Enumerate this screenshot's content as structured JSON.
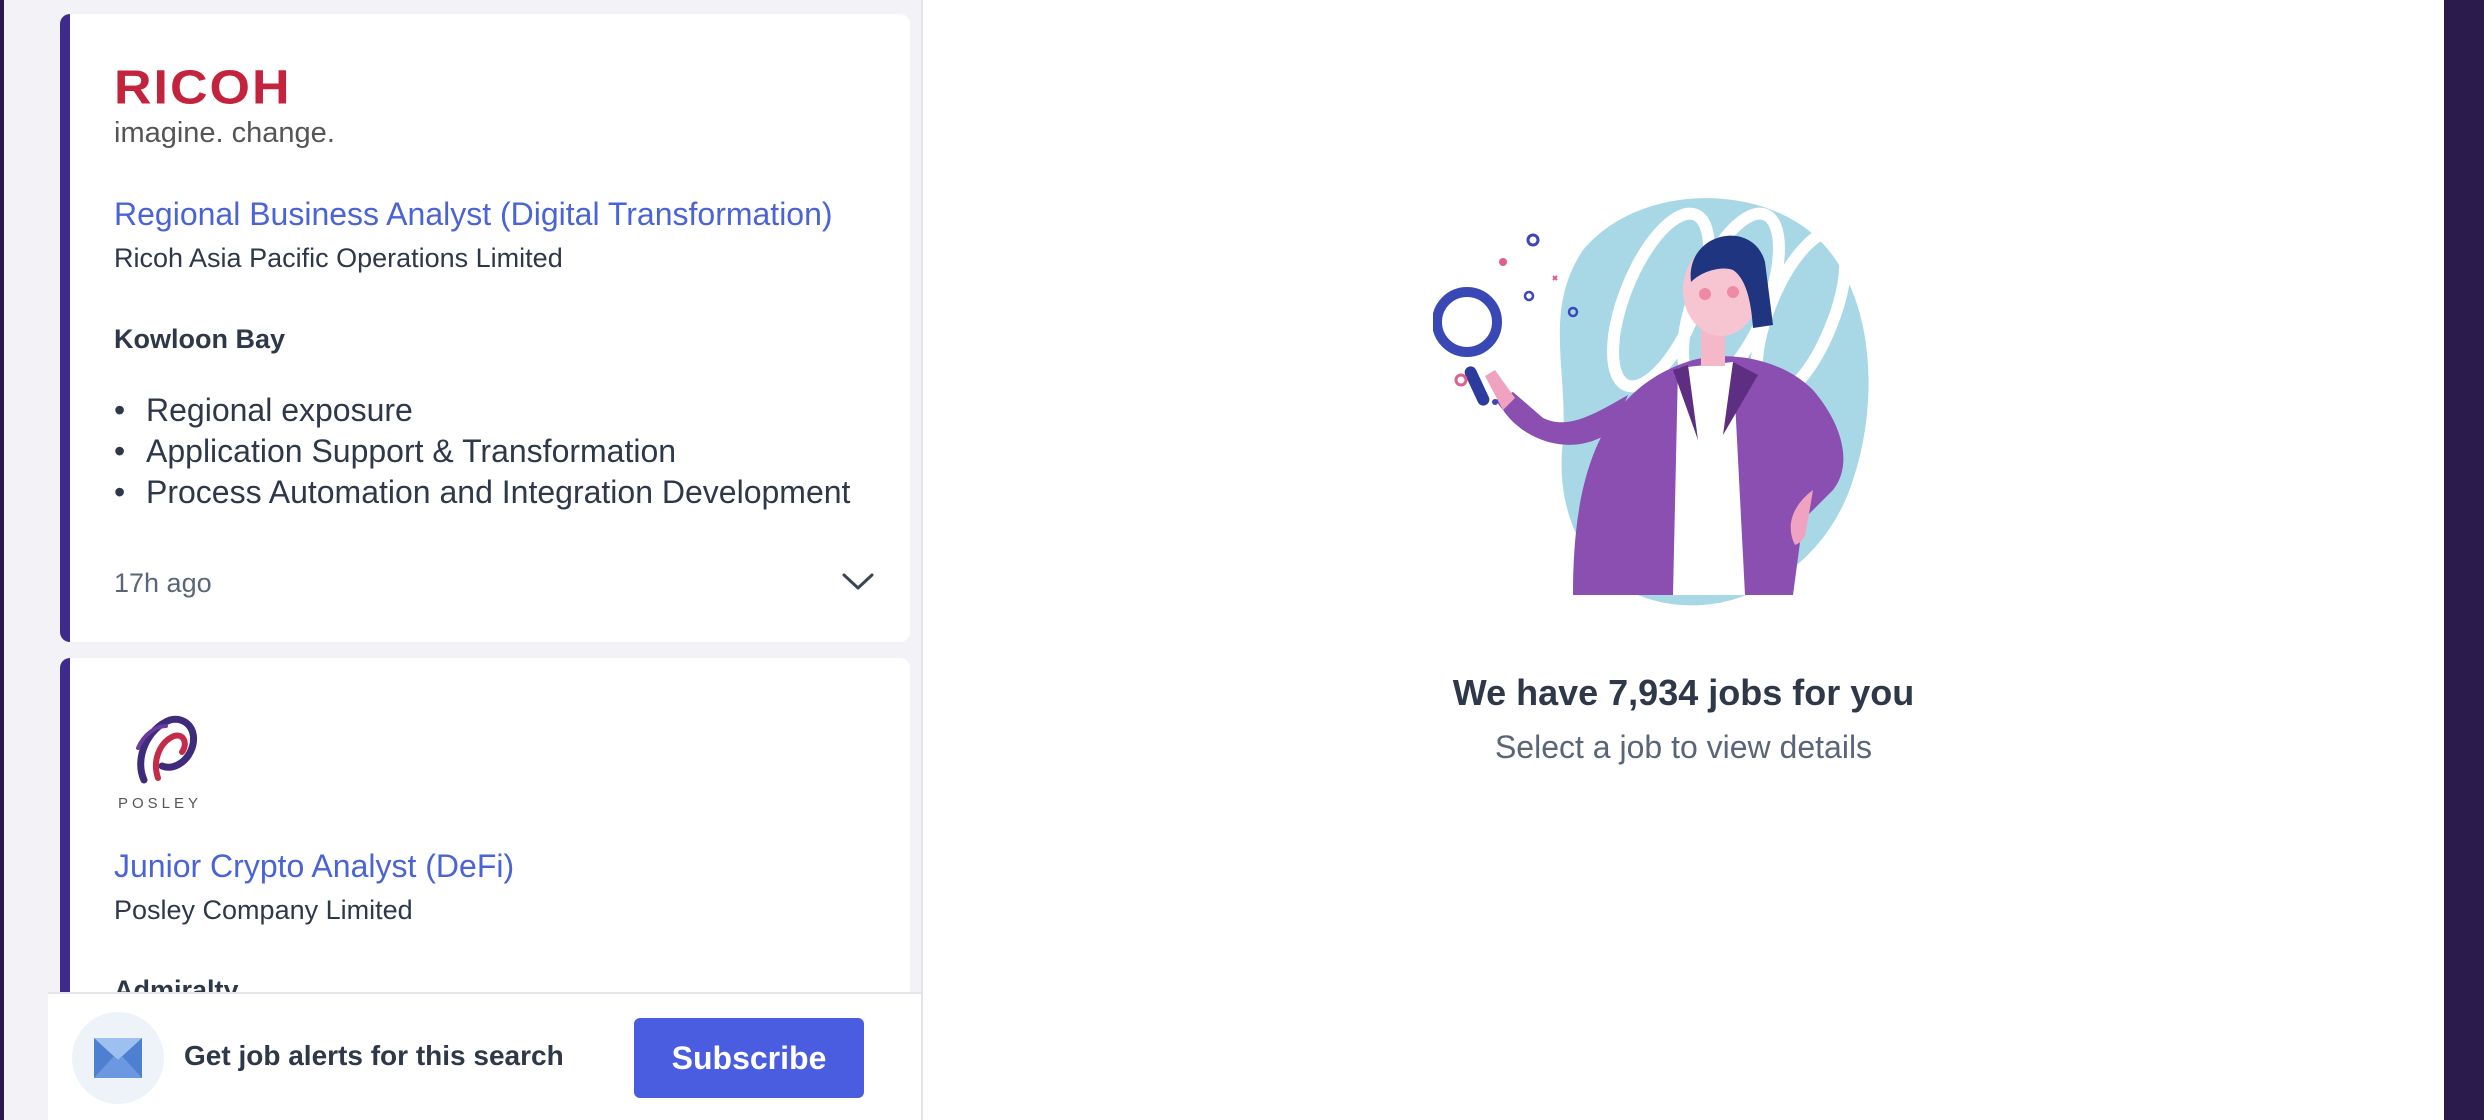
{
  "jobs": [
    {
      "logo_word": "RICOH",
      "logo_tagline": "imagine. change.",
      "title": "Regional Business Analyst (Digital Transformation)",
      "company": "Ricoh Asia Pacific Operations Limited",
      "location": "Kowloon Bay",
      "highlights": [
        "Regional exposure",
        "Application Support & Transformation",
        "Process Automation and Integration Development"
      ],
      "posted": "17h ago",
      "accent": "#3f2a8e"
    },
    {
      "logo_word": "POSLEY",
      "title": "Junior Crypto Analyst (DeFi)",
      "company": "Posley Company Limited",
      "location": "Admiralty"
    }
  ],
  "alert_bar": {
    "text": "Get job alerts for this search",
    "subscribe_label": "Subscribe"
  },
  "empty_state": {
    "title": "We have 7,934 jobs for you",
    "subtitle": "Select a job to view details"
  },
  "colors": {
    "link": "#4a63d6",
    "primary_button": "#4a5de0",
    "ricoh_red": "#c4233e"
  },
  "icons": [
    "chevron-down-icon",
    "mail-icon"
  ]
}
